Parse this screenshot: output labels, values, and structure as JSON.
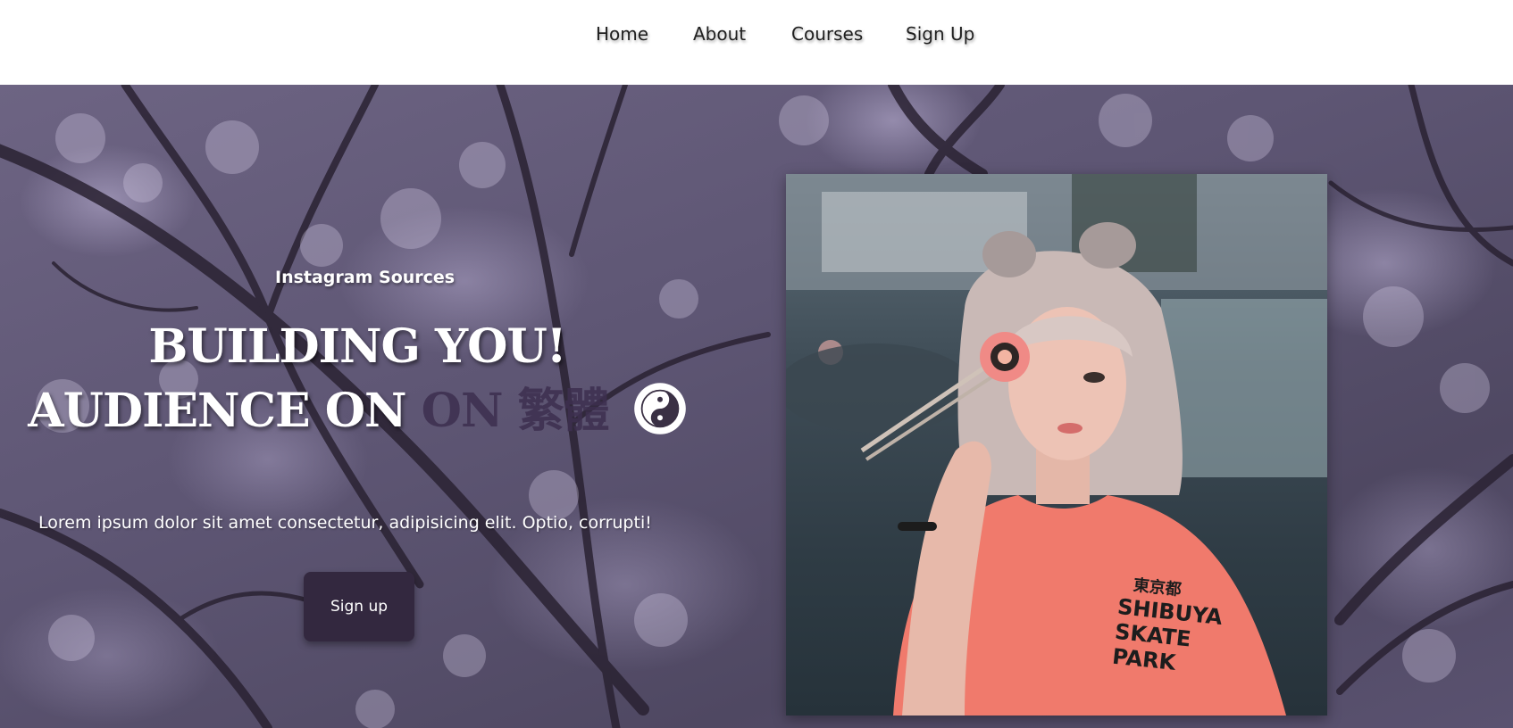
{
  "nav": {
    "items": [
      {
        "label": "Home"
      },
      {
        "label": "About"
      },
      {
        "label": "Courses"
      },
      {
        "label": "Sign Up"
      }
    ]
  },
  "hero": {
    "subtitle": "Instagram Sources",
    "title_line1": "BUILDING YOU!",
    "title_line2_main": "AUDIENCE ON",
    "title_line2_accent": "ON 繁體",
    "description": "Lorem ipsum dolor sit amet consectetur, adipisicing elit. Optio, corrupti!",
    "cta_label": "Sign up",
    "icon": "yin-yang-icon"
  },
  "photo": {
    "shirt_text": [
      "東京都",
      "SHIBUYA",
      "SKATE",
      "PARK"
    ]
  },
  "colors": {
    "button_bg": "#33283f",
    "accent_text": "#3d2f4f",
    "shirt": "#f07a6c"
  }
}
